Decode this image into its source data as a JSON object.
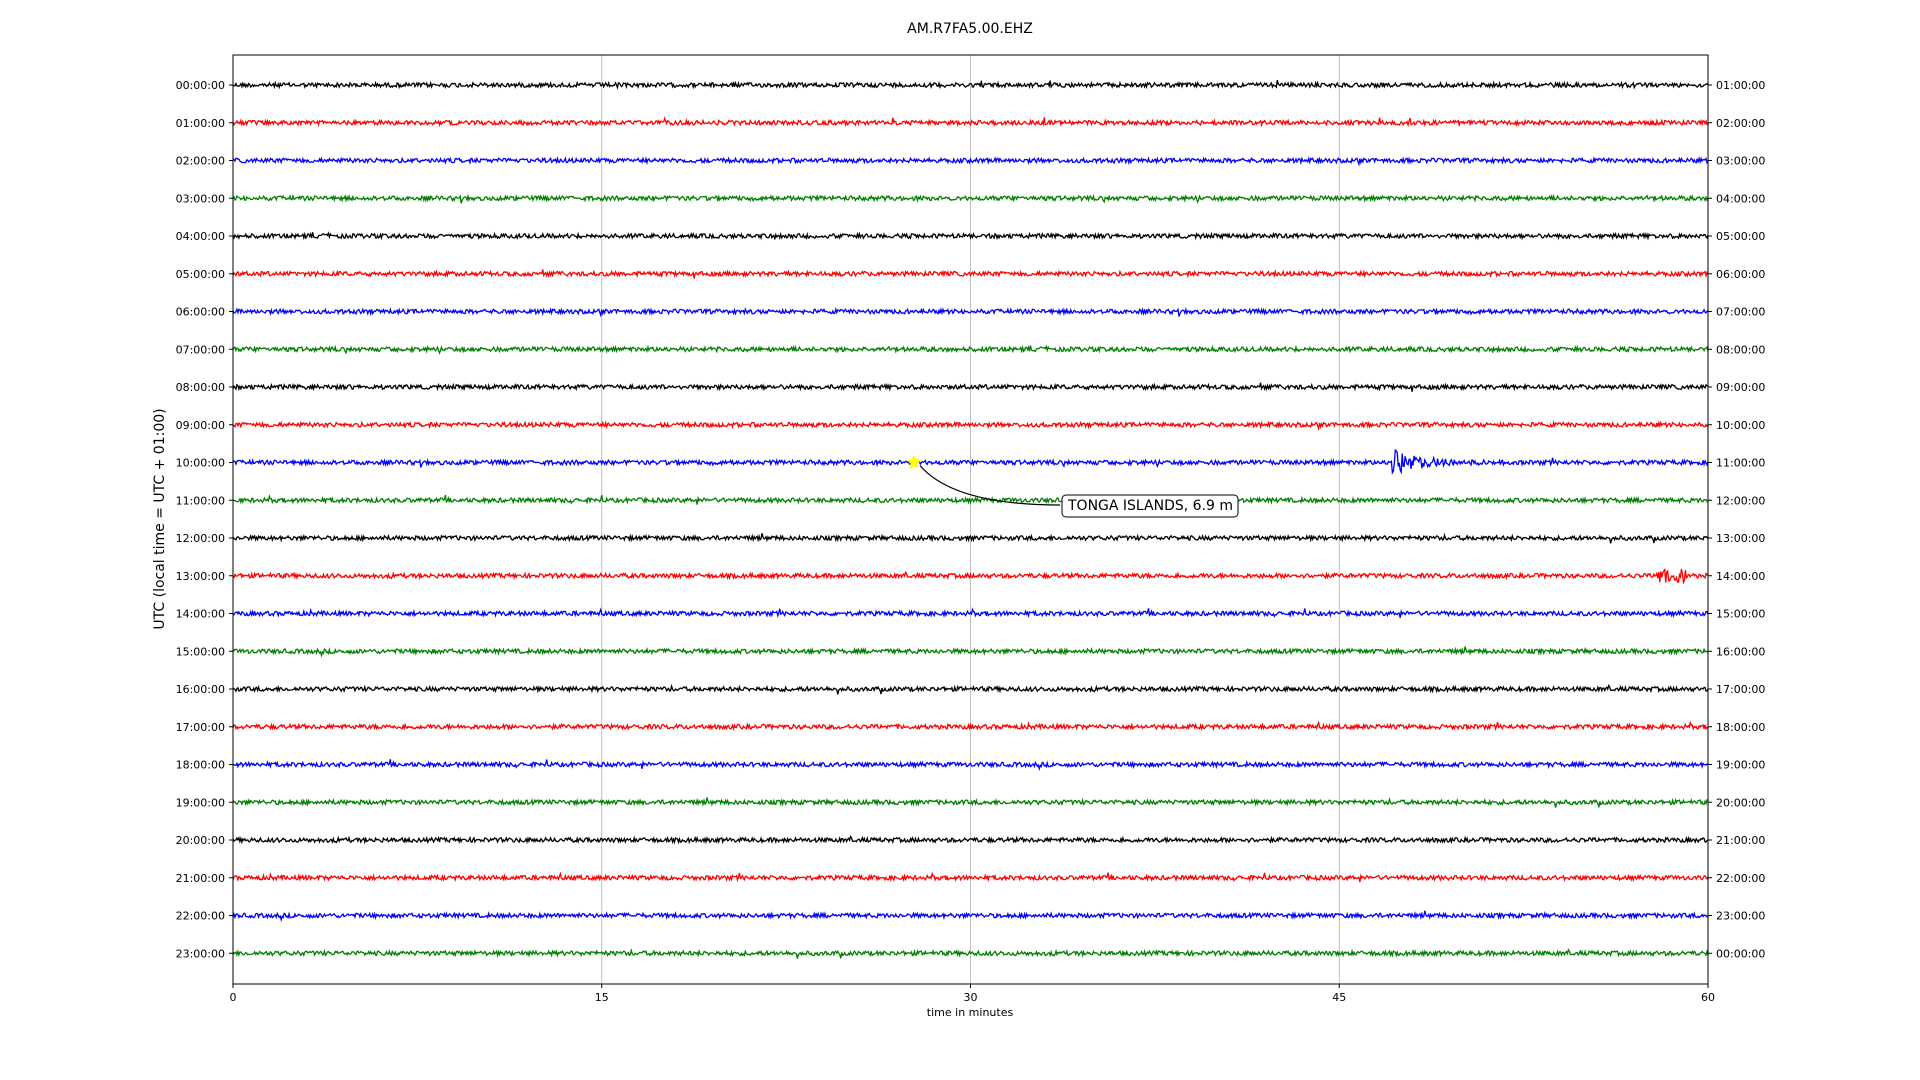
{
  "chart_data": {
    "type": "line",
    "title": "AM.R7FA5.00.EHZ",
    "xlabel": "time in minutes",
    "ylabel": "UTC (local time = UTC + 01:00)",
    "xlim": [
      0,
      60
    ],
    "x_ticks": [
      "0",
      "15",
      "30",
      "45",
      "60"
    ],
    "x_tick_values": [
      0,
      15,
      30,
      45,
      60
    ],
    "grid": "vertical",
    "left_tick_labels": [
      "00:00:00",
      "01:00:00",
      "02:00:00",
      "03:00:00",
      "04:00:00",
      "05:00:00",
      "06:00:00",
      "07:00:00",
      "08:00:00",
      "09:00:00",
      "10:00:00",
      "11:00:00",
      "12:00:00",
      "13:00:00",
      "14:00:00",
      "15:00:00",
      "16:00:00",
      "17:00:00",
      "18:00:00",
      "19:00:00",
      "20:00:00",
      "21:00:00",
      "22:00:00",
      "23:00:00"
    ],
    "right_tick_labels": [
      "01:00:00",
      "02:00:00",
      "03:00:00",
      "04:00:00",
      "05:00:00",
      "06:00:00",
      "07:00:00",
      "08:00:00",
      "09:00:00",
      "10:00:00",
      "11:00:00",
      "12:00:00",
      "13:00:00",
      "14:00:00",
      "15:00:00",
      "16:00:00",
      "17:00:00",
      "18:00:00",
      "19:00:00",
      "20:00:00",
      "21:00:00",
      "22:00:00",
      "23:00:00",
      "00:00:00"
    ],
    "trace_colors": [
      "#000000",
      "#ff0000",
      "#0000ff",
      "#008000"
    ],
    "events": [
      {
        "trace": 10,
        "minute": 47.1,
        "description": "large seismic arrival"
      },
      {
        "trace": 13,
        "minute": 58.5,
        "description": "burst"
      }
    ],
    "annotation": {
      "text": "TONGA ISLANDS, 6.9 m",
      "trace": 10,
      "minute": 27.7,
      "marker_color": "#ffff00"
    }
  }
}
